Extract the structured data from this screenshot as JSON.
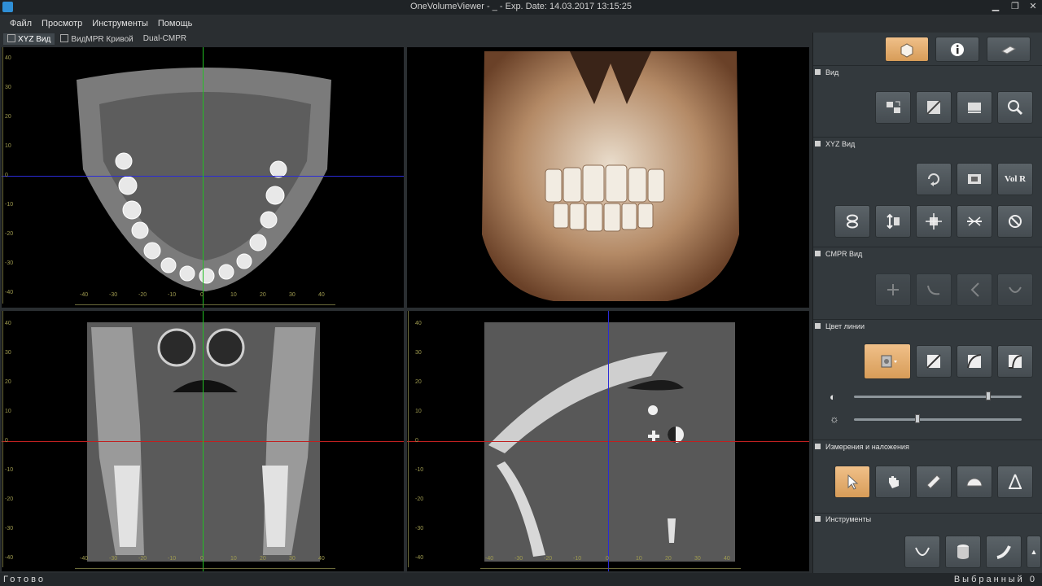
{
  "window": {
    "title": "OneVolumeViewer - _ - Exp. Date: 14.03.2017 13:15:25",
    "minimize": "▁",
    "maximize": "❐",
    "close": "✕"
  },
  "menu": [
    "Файл",
    "Просмотр",
    "Инструменты",
    "Помощь"
  ],
  "tabs": [
    "XYZ Вид",
    "ВидMPR Кривой",
    "Dual-CMPR"
  ],
  "axis_ticks": {
    "vertical": [
      "40",
      "30",
      "20",
      "10",
      "0",
      "-10",
      "-20",
      "-30",
      "-40"
    ],
    "horizontal": [
      "-40",
      "-30",
      "-20",
      "-10",
      "0",
      "10",
      "20",
      "30",
      "40"
    ]
  },
  "status": {
    "left": "Готово",
    "right": "Выбранный 0"
  },
  "panel": {
    "sections": {
      "view": "Вид",
      "xyz": "XYZ Вид",
      "cmpr": "CMPR Вид",
      "line_color": "Цвет линии",
      "measure": "Измерения и наложения",
      "tools": "Инструменты"
    },
    "vol_r_label": "Vol R",
    "brightness_level": 0.8,
    "contrast_level": 0.38,
    "colors": {
      "active_button": "#e3a866",
      "crosshair_blue": "#2b2bd6",
      "crosshair_green": "#22c022",
      "crosshair_red": "#c02020"
    }
  }
}
